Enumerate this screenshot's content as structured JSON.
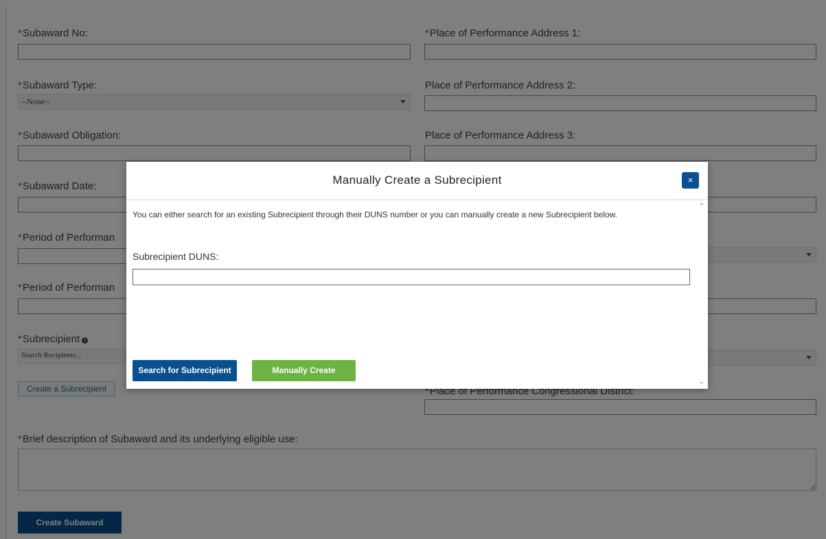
{
  "form": {
    "required_mark": "*",
    "subaward_no_label": "Subaward No:",
    "subaward_type_label": "Subaward Type:",
    "subaward_type_value": "--None--",
    "subaward_obligation_label": "Subaward Obligation:",
    "subaward_date_label": "Subaward Date:",
    "period_start_label": "Period of Performan",
    "period_end_label": "Period of Performan",
    "subrecipient_label": "Subrecipient",
    "subrecipient_info_icon": "info-icon",
    "subrecipient_search_placeholder": "Search Recipients...",
    "create_subrecipient_label": "Create a Subrecipient",
    "pop_address1_label": "Place of Performance Address 1:",
    "pop_address2_label": "Place of Performance Address 2:",
    "pop_address3_label": "Place of Performance Address 3:",
    "pop_congressional_label": "Place of Performance Congressional District:",
    "description_label": "Brief description of Subaward and its underlying eligible use:",
    "create_subaward_label": "Create Subaward"
  },
  "modal": {
    "title": "Manually Create a Subrecipient",
    "close_label": "×",
    "intro": "You can either search for an existing Subrecipient through their DUNS number or you can manually create a new Subrecipient below.",
    "duns_label": "Subrecipient DUNS:",
    "duns_value": "",
    "search_button": "Search for Subrecipient",
    "manual_button": "Manually Create"
  },
  "colors": {
    "primary": "#0b4f8f",
    "success": "#6db344",
    "required": "#c23934",
    "overlay": "rgba(0,0,0,0.5)"
  }
}
